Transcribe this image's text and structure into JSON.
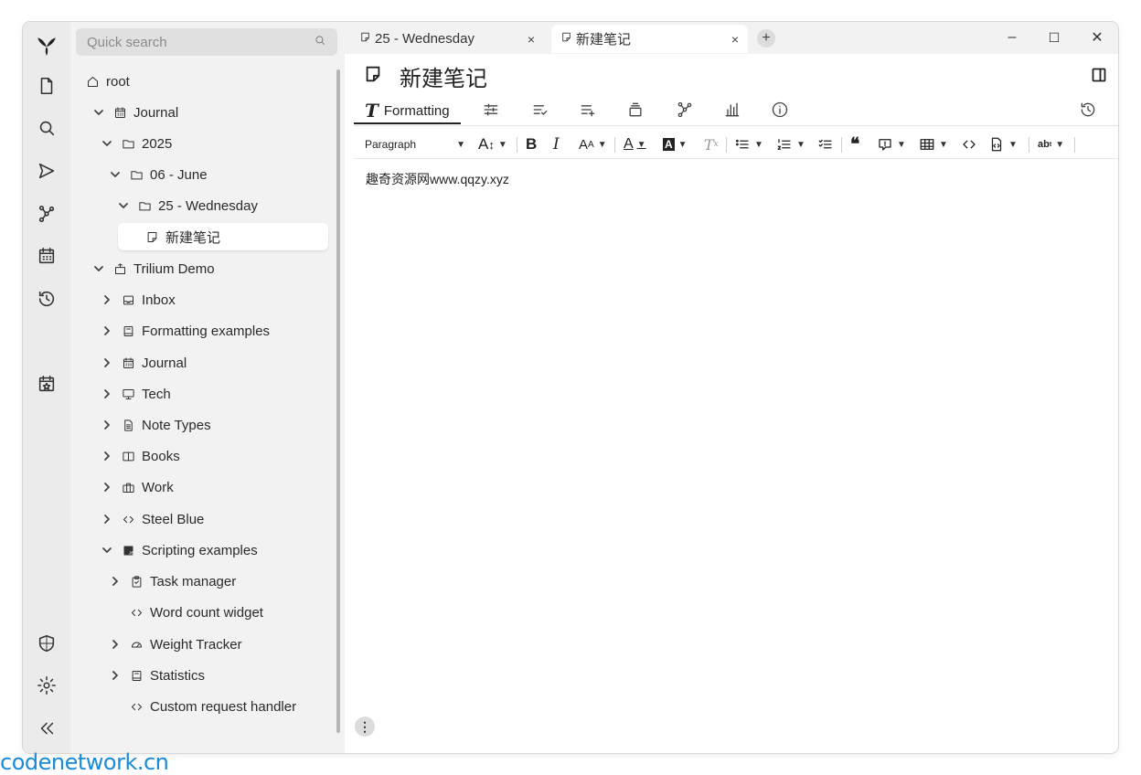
{
  "search": {
    "placeholder": "Quick search"
  },
  "tree": {
    "root": "root",
    "journal": "Journal",
    "year": "2025",
    "month": "06 - June",
    "day": "25 - Wednesday",
    "new_note": "新建笔记",
    "demo": "Trilium Demo",
    "inbox": "Inbox",
    "formatting_examples": "Formatting examples",
    "demo_journal": "Journal",
    "tech": "Tech",
    "note_types": "Note Types",
    "books": "Books",
    "work": "Work",
    "steel_blue": "Steel Blue",
    "scripting_examples": "Scripting examples",
    "task_manager": "Task manager",
    "word_count_widget": "Word count widget",
    "weight_tracker": "Weight Tracker",
    "statistics": "Statistics",
    "custom_request_handler": "Custom request handler"
  },
  "tabs": [
    {
      "label": "25 - Wednesday",
      "close": "×"
    },
    {
      "label": "新建笔记",
      "close": "×"
    }
  ],
  "window_controls": {
    "minimize": "–",
    "maximize": "☐",
    "close": "✕"
  },
  "note": {
    "title": "新建笔记",
    "content": "趣奇资源网www.qqzy.xyz"
  },
  "ribbon": {
    "formatting_label": "Formatting"
  },
  "toolbar": {
    "paragraph": "Paragraph"
  },
  "watermark": "codenetwork.cn"
}
